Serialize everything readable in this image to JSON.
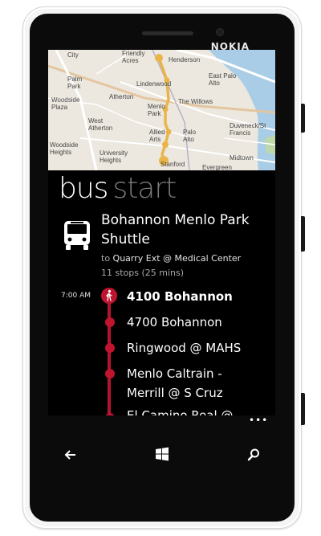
{
  "device": {
    "brand": "NOKIA"
  },
  "map": {
    "labels": [
      {
        "text": "City",
        "name": "map-label-city"
      },
      {
        "text": "Friendly\nAcres",
        "name": "map-label-friendly-acres"
      },
      {
        "text": "Henderson",
        "name": "map-label-henderson"
      },
      {
        "text": "East Palo\nAlto",
        "name": "map-label-east-palo-alto"
      },
      {
        "text": "Palm\nPark",
        "name": "map-label-palm-park"
      },
      {
        "text": "Lindenwood",
        "name": "map-label-lindenwood"
      },
      {
        "text": "Woodside\nPlaza",
        "name": "map-label-woodside-plaza"
      },
      {
        "text": "Atherton",
        "name": "map-label-atherton"
      },
      {
        "text": "The Willows",
        "name": "map-label-the-willows"
      },
      {
        "text": "West\nAtherton",
        "name": "map-label-west-atherton"
      },
      {
        "text": "Menlo\nPark",
        "name": "map-label-menlo-park"
      },
      {
        "text": "Duveneck/St\nFrancis",
        "name": "map-label-duveneck"
      },
      {
        "text": "Allied\nArts",
        "name": "map-label-allied-arts"
      },
      {
        "text": "Palo\nAlto",
        "name": "map-label-palo-alto"
      },
      {
        "text": "Woodside\nHeights",
        "name": "map-label-woodside-heights"
      },
      {
        "text": "University\nHeights",
        "name": "map-label-university-heights"
      },
      {
        "text": "Stanford",
        "name": "map-label-stanford"
      },
      {
        "text": "Midtown",
        "name": "map-label-midtown"
      },
      {
        "text": "Evergreen",
        "name": "map-label-evergreen"
      }
    ]
  },
  "header": {
    "title": "bus",
    "subtitle": "start"
  },
  "route": {
    "name": "Bohannon Menlo Park Shuttle",
    "dest_prefix": "to",
    "destination": "Quarry Ext @ Medical Center",
    "stops_summary": "11 stops (25 mins)"
  },
  "stops": {
    "first_time": "7:00 AM",
    "items": [
      "4100 Bohannon",
      "4700 Bohannon",
      "Ringwood @ MAHS",
      "Menlo Caltrain -\nMerrill @ S Cruz",
      "El Camino Real @"
    ]
  },
  "appbar": {
    "more": "•••"
  },
  "icons": {
    "back": "back-arrow-icon",
    "start": "windows-logo-icon",
    "search": "search-icon",
    "bus": "bus-icon",
    "walk": "pedestrian-icon"
  },
  "colors": {
    "accent": "#c0142e",
    "background": "#000000",
    "map_water": "#a9cde6"
  }
}
